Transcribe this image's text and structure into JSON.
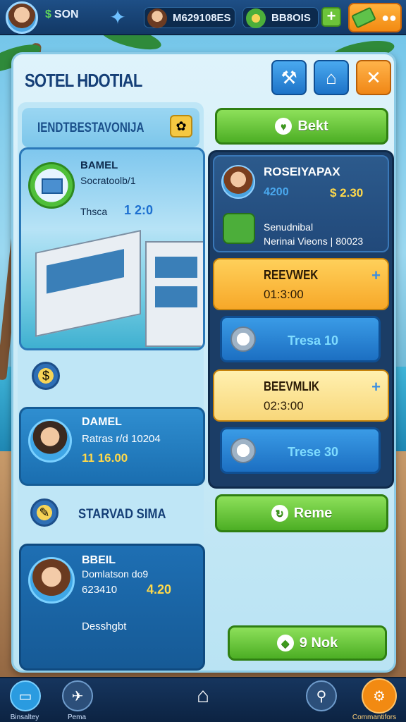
{
  "topbar": {
    "money": "SON",
    "money_symbol": "$",
    "resource_1": "M629108ES",
    "resource_2": "BB8OIS",
    "plus": "+"
  },
  "panel": {
    "title": "SOTEL HDOTIAL",
    "section_header": "IENDTBESTAVONIJA",
    "hotel_card": {
      "name": "BAMEL",
      "subtitle": "Socratoolb/1",
      "stat_label": "Thsca",
      "stat_value": "1 2:0"
    },
    "staff_card": {
      "name": "DAMEL",
      "line": "Ratras r/d 10204",
      "value": "11 16.00"
    },
    "starvad_label": "STARVAD SIMA",
    "profile_card": {
      "name": "BBEIL",
      "subtitle": "Domlatson do9",
      "number": "623410",
      "value": "4.20",
      "footer": "Desshgbt"
    },
    "btn_top": "Bekt",
    "reservation": {
      "title": "ROSEIYAPAX",
      "value_a": "4200",
      "value_b": "$ 2.30",
      "line1": "Senudnibal",
      "line2": "Nerinai Vieons | 80023"
    },
    "task_1": {
      "title": "REEVWEK",
      "time": "01:3:00",
      "plus": "+"
    },
    "pill_1": "Tresa 10",
    "task_2": {
      "title": "BEEVMLIK",
      "time": "02:3:00",
      "plus": "+"
    },
    "pill_2": "Trese 30",
    "btn_rename": "Reme",
    "btn_nok": "9 Nok"
  },
  "bottomnav": {
    "items": [
      {
        "label": "Binsaltey"
      },
      {
        "label": "Pema"
      },
      {
        "label": ""
      },
      {
        "label": ""
      },
      {
        "label": "Commantifors"
      }
    ]
  },
  "colors": {
    "topbar": "#123865",
    "panel": "#dff3fb",
    "accent_green": "#4cae24",
    "accent_orange": "#f28a12",
    "accent_blue": "#1d73c8"
  }
}
